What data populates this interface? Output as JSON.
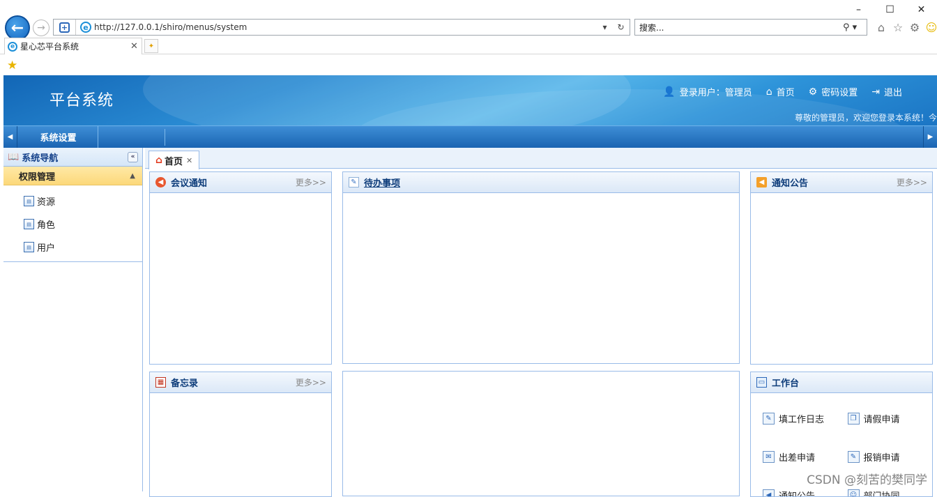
{
  "browser": {
    "window_controls": [
      "–",
      "☐",
      "✕"
    ],
    "address": "http://127.0.0.1/shiro/menus/system",
    "search_placeholder": "搜索...",
    "tab_title": "星心芯平台系统"
  },
  "header": {
    "title": "平台系统",
    "login_label": "登录用户：管理员",
    "home_label": "首页",
    "password_label": "密码设置",
    "logout_label": "退出",
    "welcome": "尊敬的管理员，欢迎您登录本系统！今"
  },
  "menubar": {
    "items": [
      {
        "label": "系统设置"
      }
    ]
  },
  "sidebar": {
    "title": "系统导航",
    "group": "权限管理",
    "items": [
      {
        "label": "资源"
      },
      {
        "label": "角色"
      },
      {
        "label": "用户"
      }
    ]
  },
  "tabs": {
    "home": "首页"
  },
  "panels": {
    "meeting": {
      "title": "会议通知",
      "more": "更多>>"
    },
    "todo": {
      "title": "待办事项"
    },
    "notice": {
      "title": "通知公告",
      "more": "更多>>"
    },
    "memo": {
      "title": "备忘录",
      "more": "更多>>"
    },
    "workbench": {
      "title": "工作台",
      "items": [
        {
          "label": "填工作日志"
        },
        {
          "label": "请假申请"
        },
        {
          "label": "出差申请"
        },
        {
          "label": "报销申请"
        },
        {
          "label": "通知公告"
        },
        {
          "label": "部门协同"
        }
      ]
    }
  },
  "watermark": "CSDN @刻苦的樊同学",
  "colors": {
    "header_blue": "#2a8bd3",
    "menubar_blue": "#1a64b2",
    "group_yellow": "#fcd87a",
    "panel_border": "#99bbe8"
  }
}
